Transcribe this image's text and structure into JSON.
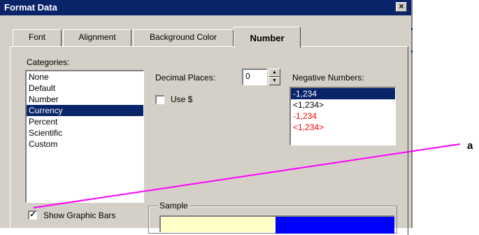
{
  "window": {
    "title": "Format Data",
    "close_glyph": "×"
  },
  "tabs": [
    {
      "label": "Font",
      "active": false
    },
    {
      "label": "Alignment",
      "active": false
    },
    {
      "label": "Background Color",
      "active": false
    },
    {
      "label": "Number",
      "active": true
    }
  ],
  "categories": {
    "label": "Categories:",
    "items": [
      "None",
      "Default",
      "Number",
      "Currency",
      "Percent",
      "Scientific",
      "Custom"
    ],
    "selected": "Currency"
  },
  "decimal_places": {
    "label": "Decimal Places:",
    "value": "0"
  },
  "use_dollar": {
    "label": "Use $",
    "checked": false
  },
  "negative_numbers": {
    "label": "Negative Numbers:",
    "items": [
      {
        "text": "-1,234",
        "color": "#000000",
        "selected": true
      },
      {
        "text": "<1,234>",
        "color": "#000000",
        "selected": false
      },
      {
        "text": "-1,234",
        "color": "#ff0000",
        "selected": false
      },
      {
        "text": "<1,234>",
        "color": "#ff0000",
        "selected": false
      }
    ]
  },
  "show_graphic_bars": {
    "label": "Show Graphic Bars",
    "checked": true,
    "check_glyph": "✓"
  },
  "sample": {
    "label": "Sample",
    "background_color": "#ffffc8",
    "bar_color": "#0000ff"
  },
  "annotation": {
    "letter": "a",
    "line_color": "#ff00ff"
  },
  "colors": {
    "titlebar": "#0a246a",
    "selection": "#0a246a",
    "dialog_face": "#d4d0c8"
  }
}
